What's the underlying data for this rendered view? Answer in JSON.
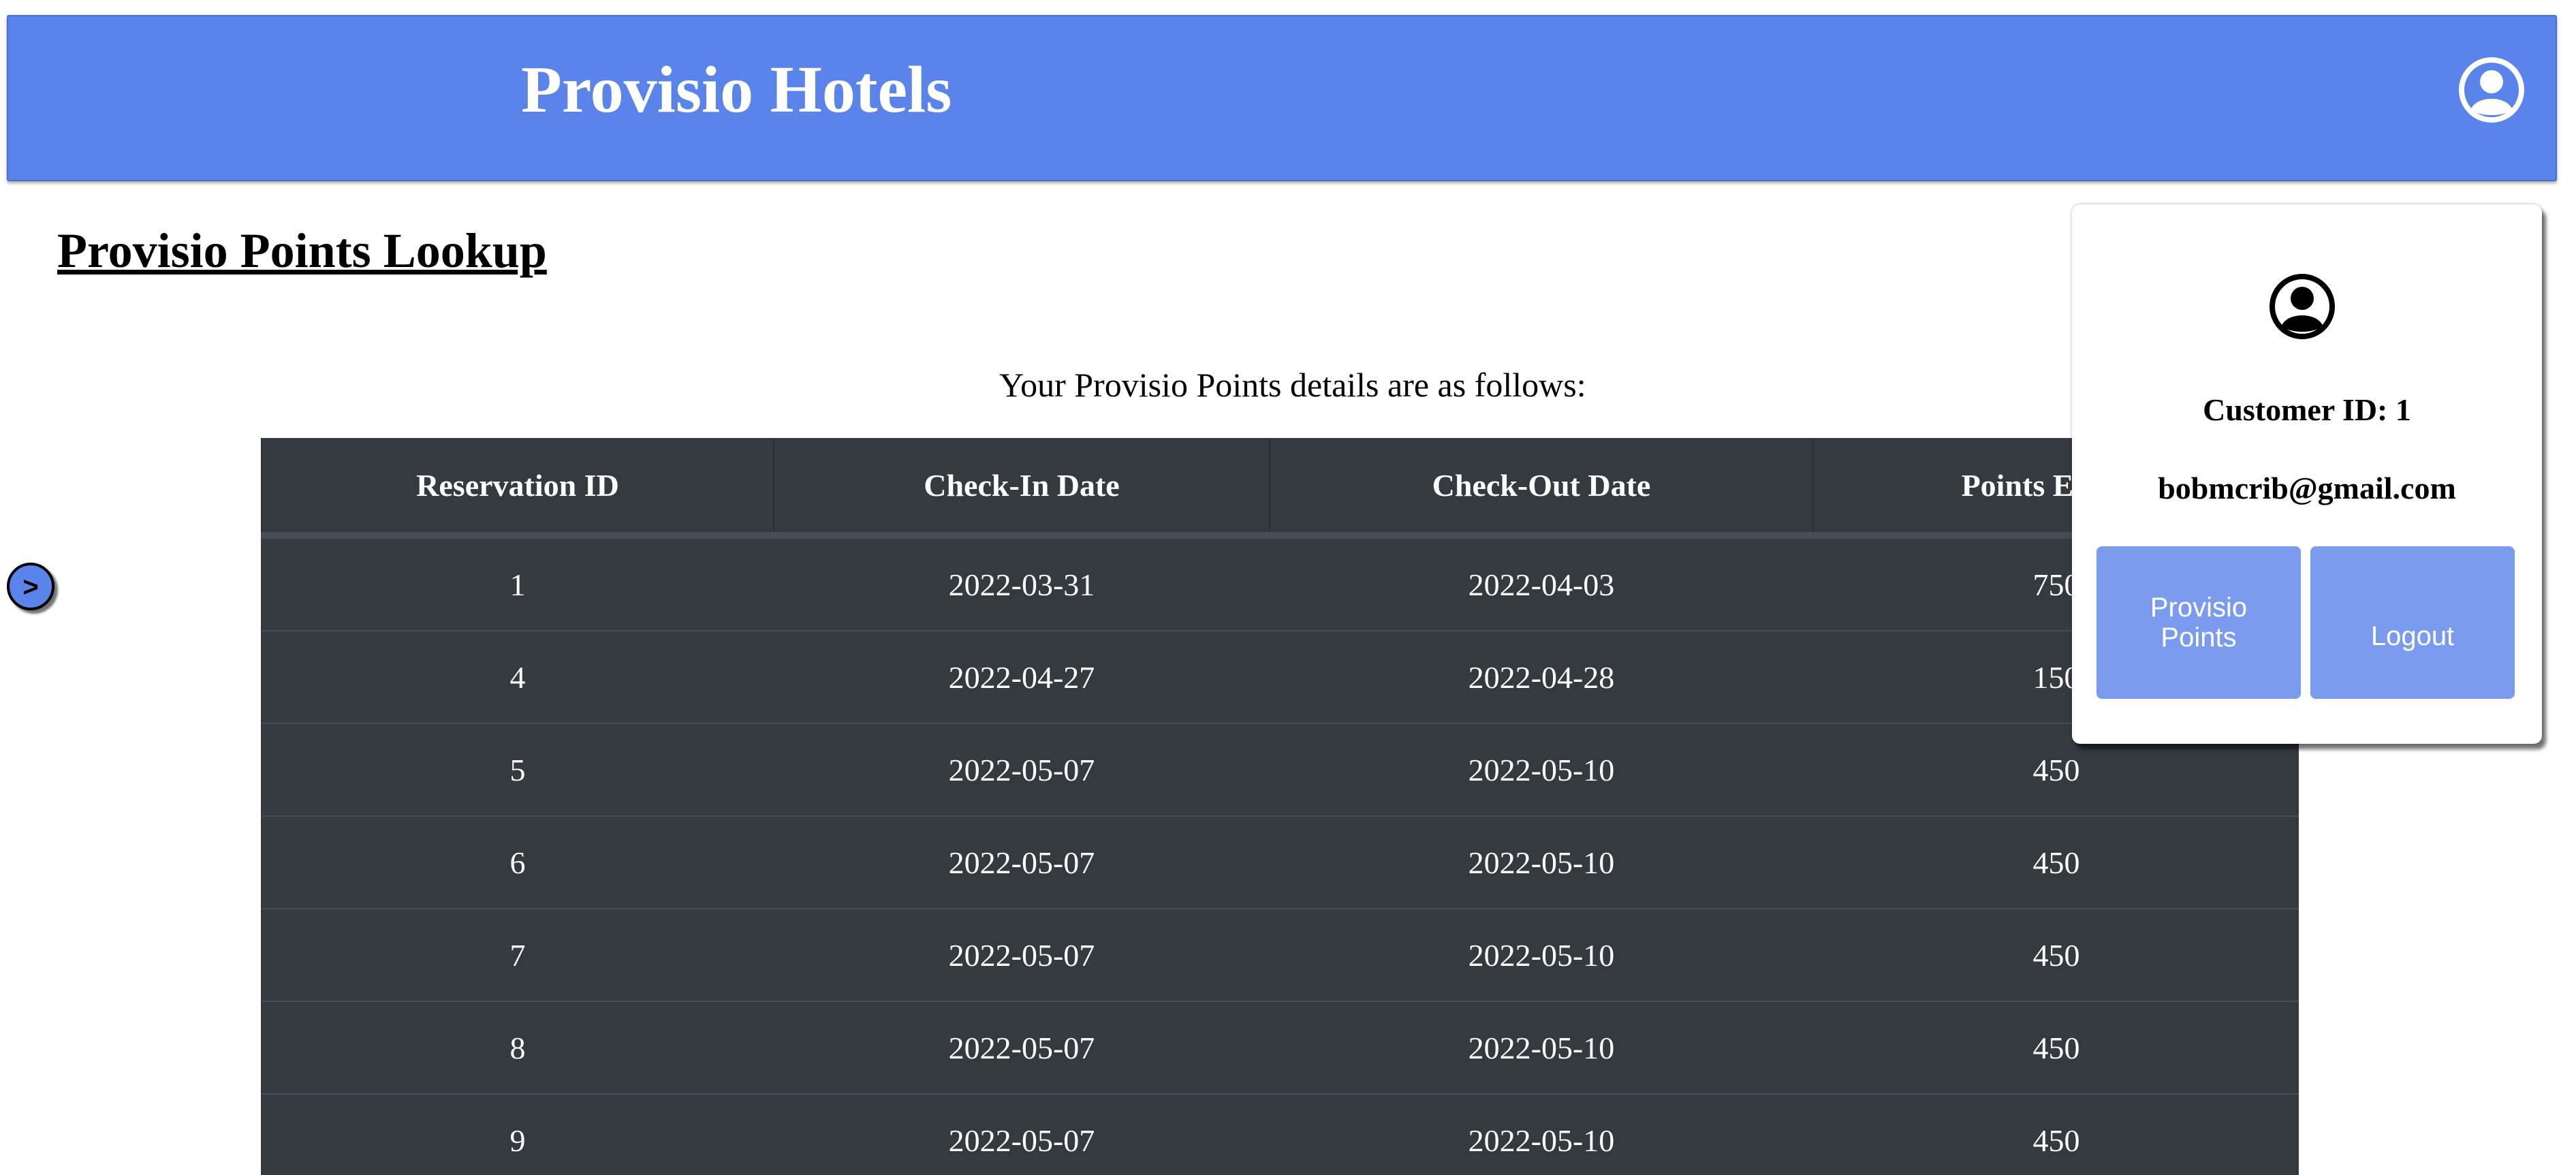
{
  "header": {
    "brand": "Provisio Hotels",
    "account_icon": "account-circle-icon"
  },
  "page": {
    "title": "Provisio Points Lookup",
    "intro": "Your Provisio Points details are as follows:",
    "side_toggle_label": ">"
  },
  "table": {
    "columns": [
      "Reservation ID",
      "Check-In Date",
      "Check-Out Date",
      "Points Earned"
    ],
    "rows": [
      [
        "1",
        "2022-03-31",
        "2022-04-03",
        "750"
      ],
      [
        "4",
        "2022-04-27",
        "2022-04-28",
        "150"
      ],
      [
        "5",
        "2022-05-07",
        "2022-05-10",
        "450"
      ],
      [
        "6",
        "2022-05-07",
        "2022-05-10",
        "450"
      ],
      [
        "7",
        "2022-05-07",
        "2022-05-10",
        "450"
      ],
      [
        "8",
        "2022-05-07",
        "2022-05-10",
        "450"
      ],
      [
        "9",
        "2022-05-07",
        "2022-05-10",
        "450"
      ]
    ]
  },
  "popup": {
    "icon": "account-circle-icon",
    "customer_id": "Customer ID: 1",
    "email": "bobmcrib@gmail.com",
    "points_button": "Provisio Points",
    "logout_button": "Logout"
  },
  "colors": {
    "header_bg": "#5a84e9",
    "table_bg": "#343a40",
    "button_bg": "#7b9cee"
  }
}
